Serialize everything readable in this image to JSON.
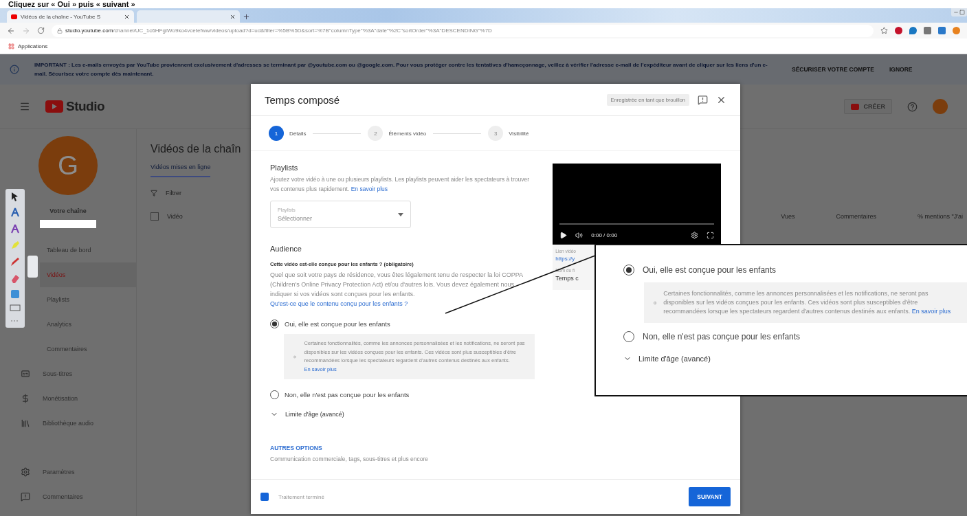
{
  "caption": "Cliquez sur « Oui » puis « suivant »",
  "browser": {
    "tabs": [
      {
        "kind": "page",
        "title": "Vidéos de la chaîne - YouTube S",
        "selected": true
      },
      {
        "kind": "blank",
        "selected": false
      }
    ],
    "url_host": "studio.youtube.com",
    "url_path": "/channel/UC_1c6HFgIWo9ko4vcetefww/videos/upload?d=ud&filter=%5B%5D&sort=%7B\"columnType\"%3A\"date\"%2C\"sortOrder\"%3A\"DESCENDING\"%7D",
    "bookmarks": [
      "Applications"
    ]
  },
  "banner": {
    "text": "IMPORTANT : Les e-mails envoyés par YouTube proviennent exclusivement d'adresses se terminant par @youtube.com ou @google.com. Pour vous protéger contre les tentatives d'hameçonnage, veillez à vérifier l'adresse e-mail de l'expéditeur avant de cliquer sur les liens d'un e-mail. Sécurisez votre compte dès maintenant.",
    "actions": [
      "SÉCURISER VOTRE COMPTE",
      "IGNORE"
    ]
  },
  "header": {
    "logo": "Studio",
    "create": "CRÉER"
  },
  "sidebar": {
    "avatar": "G",
    "channel": "Votre chaîne",
    "items": [
      {
        "label": "Tableau de bord",
        "selected": false
      },
      {
        "label": "Vidéos",
        "selected": true
      },
      {
        "label": "Playlists",
        "selected": false
      },
      {
        "label": "Analytics",
        "selected": false
      },
      {
        "label": "Commentaires",
        "selected": false
      },
      {
        "label": "Sous-titres",
        "selected": false
      },
      {
        "label": "Monétisation",
        "selected": false
      },
      {
        "label": "Bibliothèque audio",
        "selected": false
      }
    ],
    "footer_items": [
      "Paramètres",
      "Commentaires"
    ]
  },
  "main": {
    "title": "Vidéos de la chaîn",
    "tab": {
      "label": "Vidéos mises en ligne",
      "selected": true
    },
    "filter": "Filtrer",
    "select_all_checked": false,
    "column_video": "Vidéo",
    "columns_right": [
      "Vues",
      "Commentaires",
      "% mentions \"J'ai"
    ]
  },
  "modal": {
    "title": "Temps composé",
    "draft": "Enregistrée en tant que brouillon",
    "steps": [
      {
        "num": "1",
        "label": "Détails",
        "selected": true
      },
      {
        "num": "2",
        "label": "Éléments vidéo",
        "selected": false
      },
      {
        "num": "3",
        "label": "Visibilité",
        "selected": false
      }
    ],
    "playlists": {
      "heading": "Playlists",
      "text": "Ajoutez votre vidéo à une ou plusieurs playlists. Les playlists peuvent aider les spectateurs à trouver vos contenus plus rapidement.",
      "link": "En savoir plus",
      "field_label": "Playlists",
      "field_value": "Sélectionner"
    },
    "audience": {
      "heading": "Audience",
      "question": "Cette vidéo est-elle conçue pour les enfants ? (obligatoire)",
      "text": "Quel que soit votre pays de résidence, vous êtes légalement tenu de respecter la loi COPPA (Children's Online Privacy Protection Act) et/ou d'autres lois. Vous devez également nous indiquer si vos vidéos sont conçues pour les enfants.",
      "link": "Qu'est-ce que le contenu conçu pour les enfants ?",
      "options": [
        {
          "label": "Oui, elle est conçue pour les enfants",
          "selected": true,
          "note": "Certaines fonctionnalités, comme les annonces personnalisées et les notifications, ne seront pas disponibles sur les vidéos conçues pour les enfants. Ces vidéos sont plus susceptibles d'être recommandées lorsque les spectateurs regardent d'autres contenus destinés aux enfants.",
          "note_link": "En savoir plus"
        },
        {
          "label": "Non, elle n'est pas conçue pour les enfants",
          "selected": false
        }
      ],
      "age": {
        "label": "Limite d'âge (avancé)",
        "expanded": false
      }
    },
    "more": {
      "heading": "AUTRES OPTIONS",
      "text": "Communication commerciale, tags, sous-titres et plus encore"
    },
    "preview": {
      "time": "0:00 / 0:00",
      "link_label": "Lien vidéo",
      "link": "https://y",
      "file_label": "Nom du fi",
      "file": "Temps c"
    },
    "status": "Traitement terminé",
    "next": "SUIVANT"
  },
  "callout": {
    "options": [
      {
        "label": "Oui, elle est conçue pour les enfants",
        "selected": true,
        "note": "Certaines fonctionnalités, comme les annonces personnalisées et les notifications, ne seront pas disponibles sur les vidéos conçues pour les enfants. Ces vidéos sont plus susceptibles d'être recommandées lorsque les spectateurs regardent d'autres contenus destinés aux enfants.",
        "note_link": "En savoir plus"
      },
      {
        "label": "Non, elle n'est pas conçue pour les enfants",
        "selected": false
      }
    ],
    "age": {
      "label": "Limite d'âge (avancé)",
      "expanded": false
    }
  }
}
